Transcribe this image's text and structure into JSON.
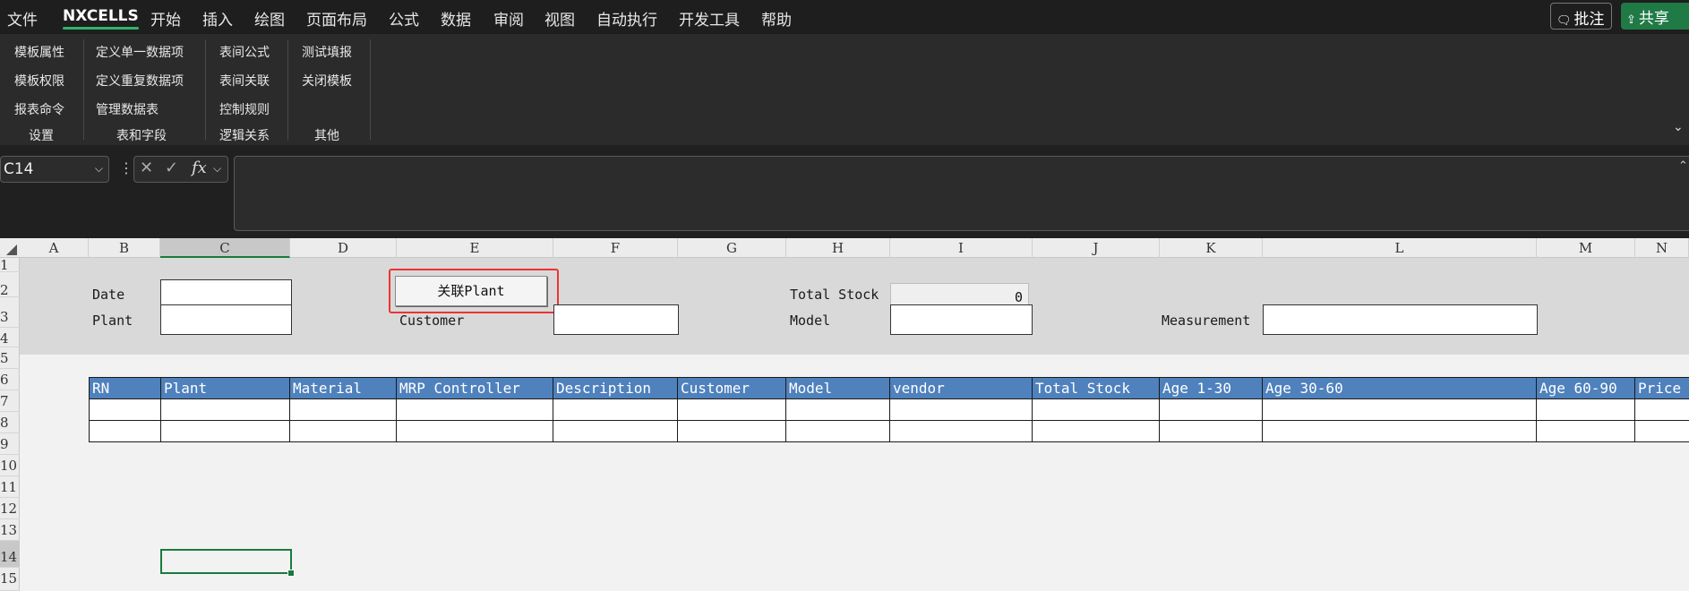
{
  "menubar": {
    "items": [
      "文件",
      "NXCELLS",
      "开始",
      "插入",
      "绘图",
      "页面布局",
      "公式",
      "数据",
      "审阅",
      "视图",
      "自动执行",
      "开发工具",
      "帮助"
    ],
    "active": "NXCELLS",
    "comment_label": "批注",
    "share_label": "共享"
  },
  "ribbon": {
    "group_settings": {
      "items": [
        "模板属性",
        "模板权限",
        "报表命令"
      ],
      "label": "设置"
    },
    "group_fields": {
      "items": [
        "定义单一数据项",
        "定义重复数据项",
        "管理数据表"
      ],
      "label": "表和字段"
    },
    "group_logic": {
      "items": [
        "表间公式",
        "表间关联",
        "控制规则"
      ],
      "label": "逻辑关系"
    },
    "group_other": {
      "items": [
        "测试填报",
        "关闭模板"
      ],
      "label": "其他"
    }
  },
  "formula_bar": {
    "namebox_value": "C14",
    "fx_label": "fx",
    "cancel_glyph": "✕",
    "enter_glyph": "✓",
    "formula_value": ""
  },
  "columns": [
    "A",
    "B",
    "C",
    "D",
    "E",
    "F",
    "G",
    "H",
    "I",
    "J",
    "K",
    "L",
    "M",
    "N"
  ],
  "selected_column": "C",
  "rows": [
    "1",
    "2",
    "3",
    "4",
    "5",
    "6",
    "7",
    "8",
    "9",
    "10",
    "11",
    "12",
    "13",
    "14",
    "15"
  ],
  "selected_row": "14",
  "form": {
    "date_label": "Date",
    "plant_label": "Plant",
    "customer_label": "Customer",
    "total_stock_label": "Total Stock",
    "total_stock_value": "0",
    "model_label": "Model",
    "measurement_label": "Measurement",
    "link_plant_button": "关联Plant"
  },
  "table": {
    "headers": [
      "RN",
      "Plant",
      "Material",
      "MRP Controller",
      "Description",
      "Customer",
      "Model",
      "vendor",
      "Total Stock",
      "Age 1-30",
      "Age 30-60",
      "Age 60-90",
      "Price"
    ],
    "rows": [
      [
        "",
        "",
        "",
        "",
        "",
        "",
        "",
        "",
        "",
        "",
        "",
        "",
        ""
      ],
      [
        "",
        "",
        "",
        "",
        "",
        "",
        "",
        "",
        "",
        "",
        "",
        "",
        ""
      ]
    ]
  },
  "colors": {
    "menubar_bg": "#1e1e1e",
    "ribbon_bg": "#2b2b2b",
    "header_blue": "#4f81bd",
    "accent_green": "#1a7a3e",
    "highlight_red": "#e33333"
  }
}
